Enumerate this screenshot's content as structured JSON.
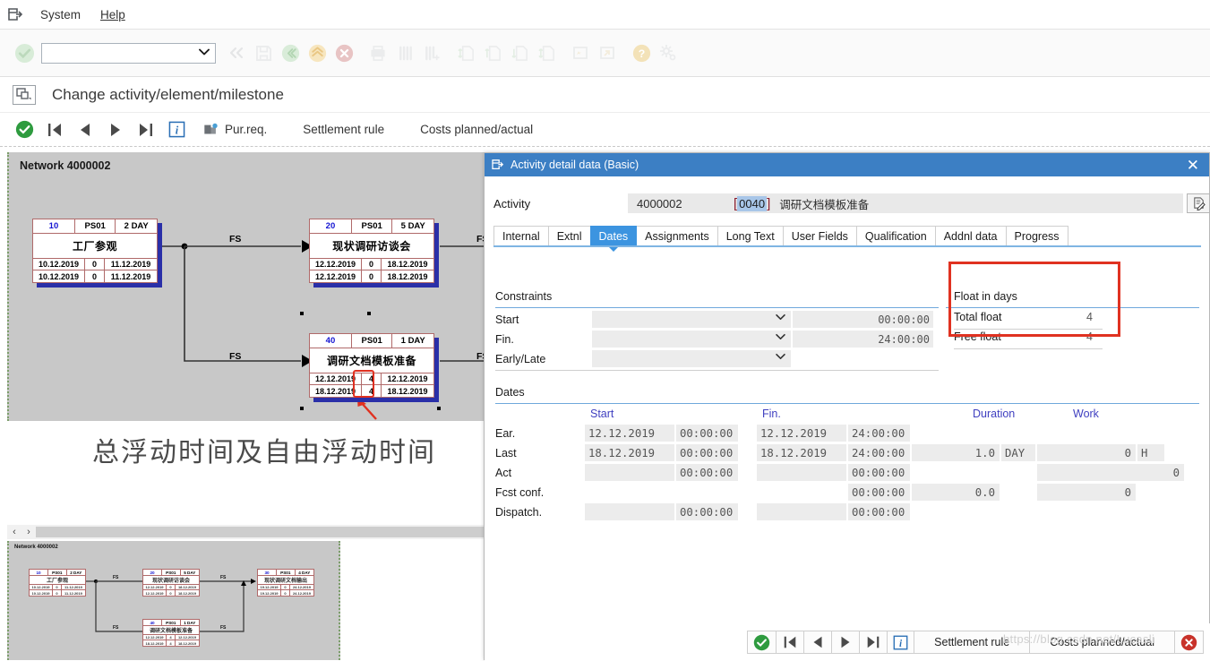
{
  "menubar": {
    "logo_icon": "sap-window-icon",
    "items": [
      {
        "label": "System",
        "accel": "S"
      },
      {
        "label": "Help",
        "accel": "H"
      }
    ]
  },
  "command_toolbar": {
    "ok_icon": "green-check-icon",
    "command_field_value": "",
    "command_field_placeholder": "",
    "dropdown_icon": "chevron-down-icon",
    "icons": [
      "back-double-icon",
      "save-icon",
      "back-icon",
      "exit-up-icon",
      "cancel-icon",
      "print-icon",
      "find-icon",
      "find-next-icon",
      "first-page-icon",
      "previous-page-icon",
      "next-page-icon",
      "last-page-icon",
      "create-session-icon",
      "create-shortcut-icon",
      "help-icon",
      "customize-icon"
    ]
  },
  "titlebar": {
    "icon": "screen-layout-icon",
    "title": "Change activity/element/milestone"
  },
  "app_toolbar": {
    "icons": [
      "enter-icon",
      "first-icon",
      "previous-icon",
      "next-icon",
      "last-icon",
      "info-icon",
      "purchase-req-icon"
    ],
    "buttons": [
      {
        "label": "Pur.req."
      },
      {
        "label": "Settlement rule"
      },
      {
        "label": "Costs planned/actual"
      }
    ]
  },
  "network": {
    "title": "Network 4000002",
    "caption": "总浮动时间及自由浮动时间",
    "relationship_label": "FS",
    "nodes": [
      {
        "number": "10",
        "work_center": "PS01",
        "duration": "2 DAY",
        "description": "工厂参观",
        "early_start": "10.12.2019",
        "float": "0",
        "early_finish": "11.12.2019",
        "late_start": "10.12.2019",
        "late_float": "0",
        "late_finish": "11.12.2019"
      },
      {
        "number": "20",
        "work_center": "PS01",
        "duration": "5 DAY",
        "description": "现状调研访谈会",
        "early_start": "12.12.2019",
        "float": "0",
        "early_finish": "18.12.2019",
        "late_start": "12.12.2019",
        "late_float": "0",
        "late_finish": "18.12.2019"
      },
      {
        "number": "40",
        "work_center": "PS01",
        "duration": "1 DAY",
        "description": "调研文档模板准备",
        "early_start": "12.12.2019",
        "float": "4",
        "early_finish": "12.12.2019",
        "late_start": "18.12.2019",
        "late_float": "4",
        "late_finish": "18.12.2019"
      }
    ],
    "scrollbar": {
      "left_arrow": "‹",
      "right_arrow": "›"
    }
  },
  "thumbnail": {
    "title": "Network 4000002",
    "relationship_label": "FS",
    "nodes": [
      {
        "number": "10",
        "work_center": "PS01",
        "duration": "2 DAY",
        "description": "工厂参观",
        "early_start": "10.12.2019",
        "float": "0",
        "early_finish": "11.12.2019",
        "late_start": "10.12.2019",
        "late_float": "0",
        "late_finish": "11.12.2019"
      },
      {
        "number": "20",
        "work_center": "PS01",
        "duration": "5 DAY",
        "description": "现状调研访谈会",
        "early_start": "12.12.2019",
        "float": "0",
        "early_finish": "18.12.2019",
        "late_start": "12.12.2019",
        "late_float": "0",
        "late_finish": "18.12.2019"
      },
      {
        "number": "30",
        "work_center": "PS01",
        "duration": "4 DAY",
        "description": "现状调研文档输出",
        "early_start": "19.12.2019",
        "float": "0",
        "early_finish": "24.12.2019",
        "late_start": "19.12.2019",
        "late_float": "0",
        "late_finish": "24.12.2019"
      },
      {
        "number": "40",
        "work_center": "PS01",
        "duration": "1 DAY",
        "description": "调研文档模板准备",
        "early_start": "12.12.2019",
        "float": "4",
        "early_finish": "12.12.2019",
        "late_start": "18.12.2019",
        "late_float": "4",
        "late_finish": "18.12.2019"
      }
    ]
  },
  "dialog": {
    "icon": "sap-window-icon",
    "title": "Activity detail data (Basic)",
    "close_icon": "close-icon",
    "activity": {
      "label": "Activity",
      "network": "4000002",
      "bracket_left": "[",
      "bracket_right": "]",
      "number": "0040",
      "description": "调研文档模板准备",
      "edit_icon": "long-text-icon"
    },
    "tabs": [
      {
        "label": "Internal",
        "active": false
      },
      {
        "label": "Extnl",
        "active": false
      },
      {
        "label": "Dates",
        "active": true
      },
      {
        "label": "Assignments",
        "active": false
      },
      {
        "label": "Long Text",
        "active": false
      },
      {
        "label": "User Fields",
        "active": false
      },
      {
        "label": "Qualification",
        "active": false
      },
      {
        "label": "Addnl data",
        "active": false
      },
      {
        "label": "Progress",
        "active": false
      }
    ],
    "constraints": {
      "title": "Constraints",
      "rows": [
        {
          "label": "Start",
          "select_value": "",
          "date_value": "",
          "time_value": "00:00:00"
        },
        {
          "label": "Fin.",
          "select_value": "",
          "date_value": "",
          "time_value": "24:00:00"
        },
        {
          "label": "Early/Late",
          "select_value": "",
          "date_value": "",
          "time_value": ""
        }
      ],
      "dropdown_icon": "chevron-down-icon"
    },
    "float_in_days": {
      "title": "Float in days",
      "rows": [
        {
          "label": "Total float",
          "value": "4"
        },
        {
          "label": "Free float",
          "value": "4"
        }
      ],
      "highlight_color": "#e03221"
    },
    "dates": {
      "title": "Dates",
      "columns": [
        "Start",
        "Fin.",
        "Duration",
        "Work"
      ],
      "rows": [
        {
          "label": "Ear.",
          "start_date": "12.12.2019",
          "start_time": "00:00:00",
          "fin_date": "12.12.2019",
          "fin_time": "24:00:00",
          "duration": "",
          "duration_unit": "",
          "work": "",
          "work_unit": ""
        },
        {
          "label": "Last",
          "start_date": "18.12.2019",
          "start_time": "00:00:00",
          "fin_date": "18.12.2019",
          "fin_time": "24:00:00",
          "duration": "1.0",
          "duration_unit": "DAY",
          "work": "0",
          "work_unit": "H"
        },
        {
          "label": "Act",
          "start_date": "",
          "start_time": "00:00:00",
          "fin_date": "",
          "fin_time": "00:00:00",
          "duration": "",
          "duration_unit": "",
          "work": "0",
          "work_unit": ""
        },
        {
          "label": "Fcst conf.",
          "start_date": "",
          "start_time": "",
          "fin_date": "",
          "fin_time": "00:00:00",
          "duration": "0.0",
          "duration_unit": "",
          "work": "0",
          "work_unit": ""
        },
        {
          "label": "Dispatch.",
          "start_date": "",
          "start_time": "00:00:00",
          "fin_date": "",
          "fin_time": "00:00:00",
          "duration": "",
          "duration_unit": "",
          "work": "",
          "work_unit": ""
        }
      ]
    },
    "footer": {
      "icons": [
        "continue-icon",
        "first-icon",
        "previous-icon",
        "next-icon",
        "last-icon",
        "info-icon"
      ],
      "buttons": [
        {
          "label": "Settlement rule"
        },
        {
          "label": "Costs planned/actual"
        }
      ],
      "cancel_icon": "cancel-red-icon"
    }
  },
  "watermark": {
    "text": "https://blog.csdn.net/Lucasli"
  }
}
